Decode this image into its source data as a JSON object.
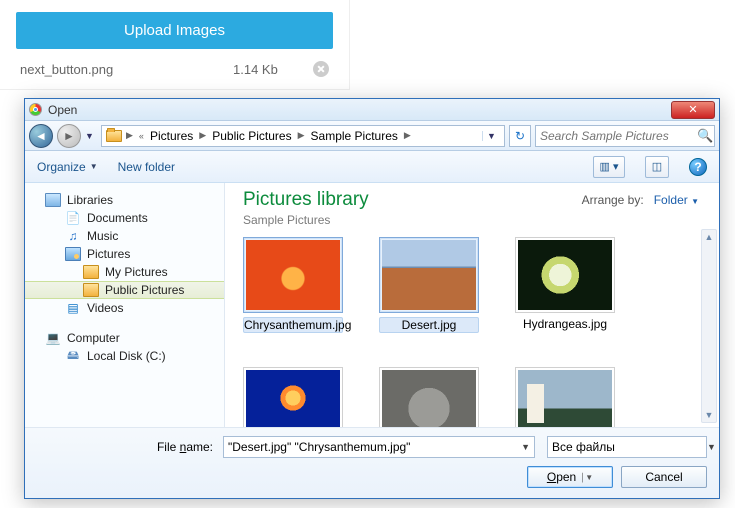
{
  "upload": {
    "button_label": "Upload Images",
    "file": {
      "name": "next_button.png",
      "size": "1.14 Kb"
    }
  },
  "dialog": {
    "title": "Open",
    "breadcrumbs": [
      "Pictures",
      "Public Pictures",
      "Sample Pictures"
    ],
    "search_placeholder": "Search Sample Pictures",
    "toolbar": {
      "organize": "Organize",
      "new_folder": "New folder"
    },
    "tree": {
      "libraries": "Libraries",
      "documents": "Documents",
      "music": "Music",
      "pictures": "Pictures",
      "my_pictures": "My Pictures",
      "public_pictures": "Public Pictures",
      "videos": "Videos",
      "computer": "Computer",
      "local_disk": "Local Disk (C:)"
    },
    "header": {
      "title": "Pictures library",
      "subtitle": "Sample Pictures",
      "arrange_label": "Arrange by:",
      "arrange_value": "Folder"
    },
    "thumbs": [
      {
        "caption": "Chrysanthemum.jpg",
        "selected": true,
        "swatch": "sw-chrys"
      },
      {
        "caption": "Desert.jpg",
        "selected": true,
        "swatch": "sw-desert"
      },
      {
        "caption": "Hydrangeas.jpg",
        "selected": false,
        "swatch": "sw-hydra"
      },
      {
        "caption": "",
        "selected": false,
        "swatch": "sw-jelly"
      },
      {
        "caption": "",
        "selected": false,
        "swatch": "sw-koala"
      },
      {
        "caption": "",
        "selected": false,
        "swatch": "sw-light"
      }
    ],
    "footer": {
      "filename_label_pre": "File ",
      "filename_label_u": "n",
      "filename_label_post": "ame:",
      "filename_value": "\"Desert.jpg\" \"Chrysanthemum.jpg\"",
      "filter_value": "Все файлы",
      "open_u": "O",
      "open_rest": "pen",
      "cancel": "Cancel"
    }
  }
}
